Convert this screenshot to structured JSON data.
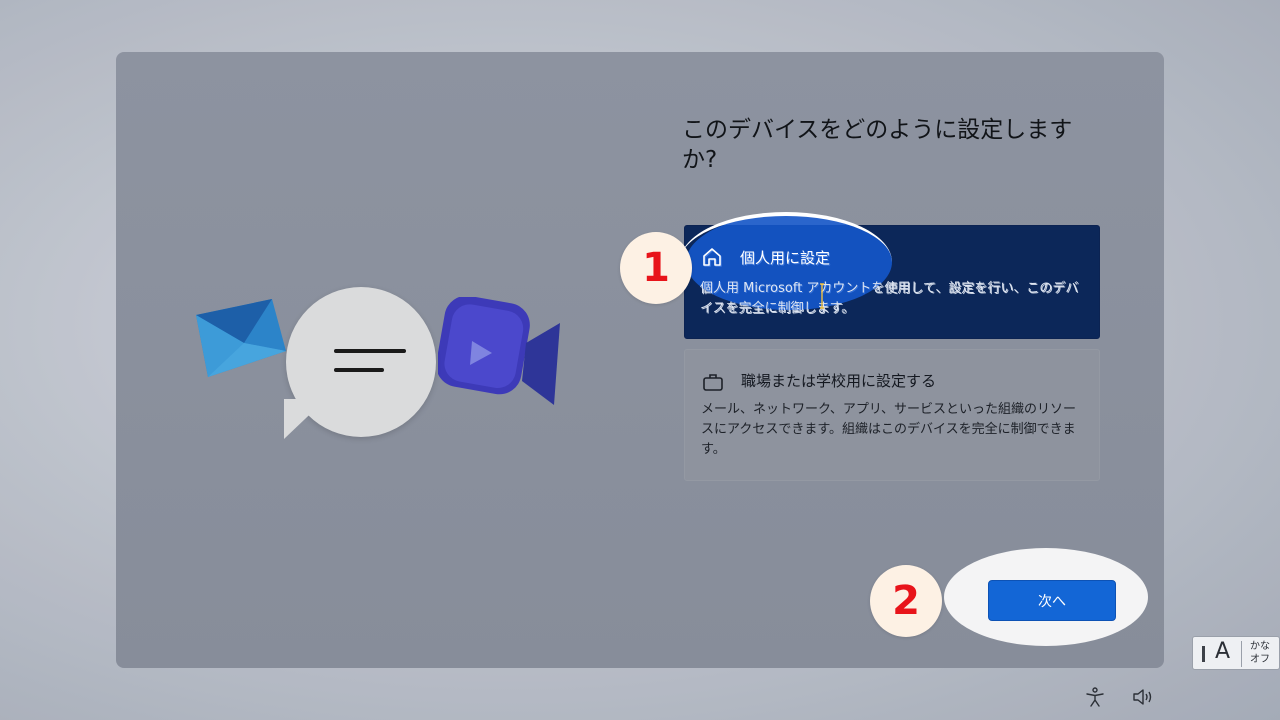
{
  "setup": {
    "title": "このデバイスをどのように設定しますか?",
    "options": [
      {
        "title": "個人用に設定",
        "description": "個人用 Microsoft アカウントを使用して、設定を行い、このデバイスを完全に制御します。",
        "icon": "home-icon",
        "selected": true
      },
      {
        "title": "職場または学校用に設定する",
        "description": "メール、ネットワーク、アプリ、サービスといった組織のリソースにアクセスできます。組織はこのデバイスを完全に制御できます。",
        "icon": "briefcase-icon",
        "selected": false
      }
    ],
    "next_label": "次へ"
  },
  "annotations": {
    "step1": "1",
    "step2": "2"
  },
  "ime": {
    "letter": "A",
    "kana_line1": "かな",
    "kana_line2": "オフ"
  },
  "colors": {
    "selected_option": "#0c2759",
    "next_button": "#1366d6",
    "annotation_number": "#e8141a"
  }
}
